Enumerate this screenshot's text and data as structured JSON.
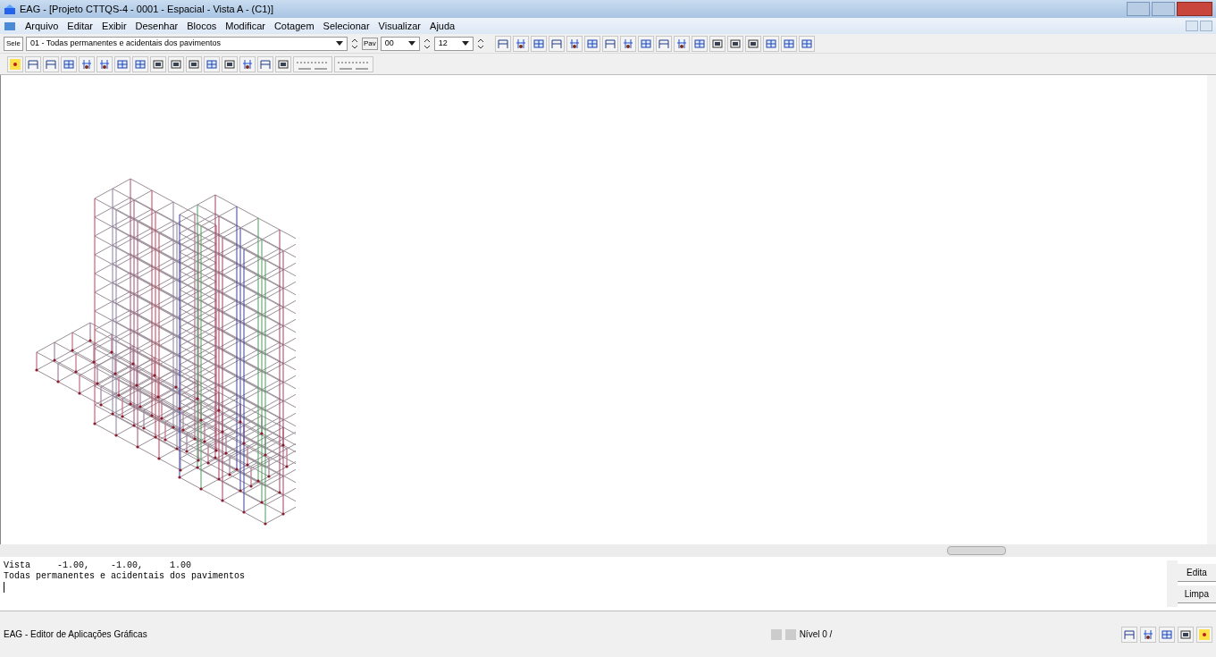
{
  "window": {
    "title": "EAG - [Projeto CTTQS-4 - 0001 - Espacial - Vista A - (C1)]"
  },
  "menu": [
    "Arquivo",
    "Editar",
    "Exibir",
    "Desenhar",
    "Blocos",
    "Modificar",
    "Cotagem",
    "Selecionar",
    "Visualizar",
    "Ajuda"
  ],
  "toolbar": {
    "select_label": "Sele",
    "load_case": "01 - Todas permanentes e acidentais dos pavimentos",
    "floor_label": "Pav",
    "floor_from": "00",
    "floor_to": "12"
  },
  "command": {
    "lines": [
      "Vista     -1.00,    -1.00,     1.00",
      "Todas permanentes e acidentais dos pavimentos"
    ],
    "buttons": [
      "Edita",
      "Limpa"
    ]
  },
  "status_bar": {
    "app": "EAG - Editor de Aplicações Gráficas",
    "level": "Nível 0 /"
  }
}
